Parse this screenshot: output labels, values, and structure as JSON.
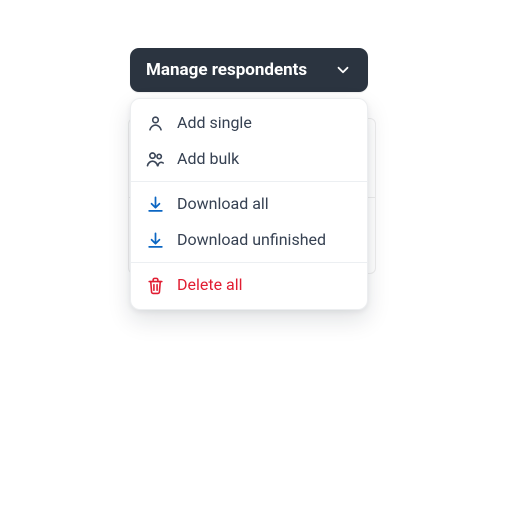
{
  "button": {
    "label": "Manage respondents"
  },
  "menu": {
    "items": {
      "add_single": "Add single",
      "add_bulk": "Add bulk",
      "download_all": "Download all",
      "download_unfinished": "Download unfinished",
      "delete_all": "Delete all"
    }
  }
}
